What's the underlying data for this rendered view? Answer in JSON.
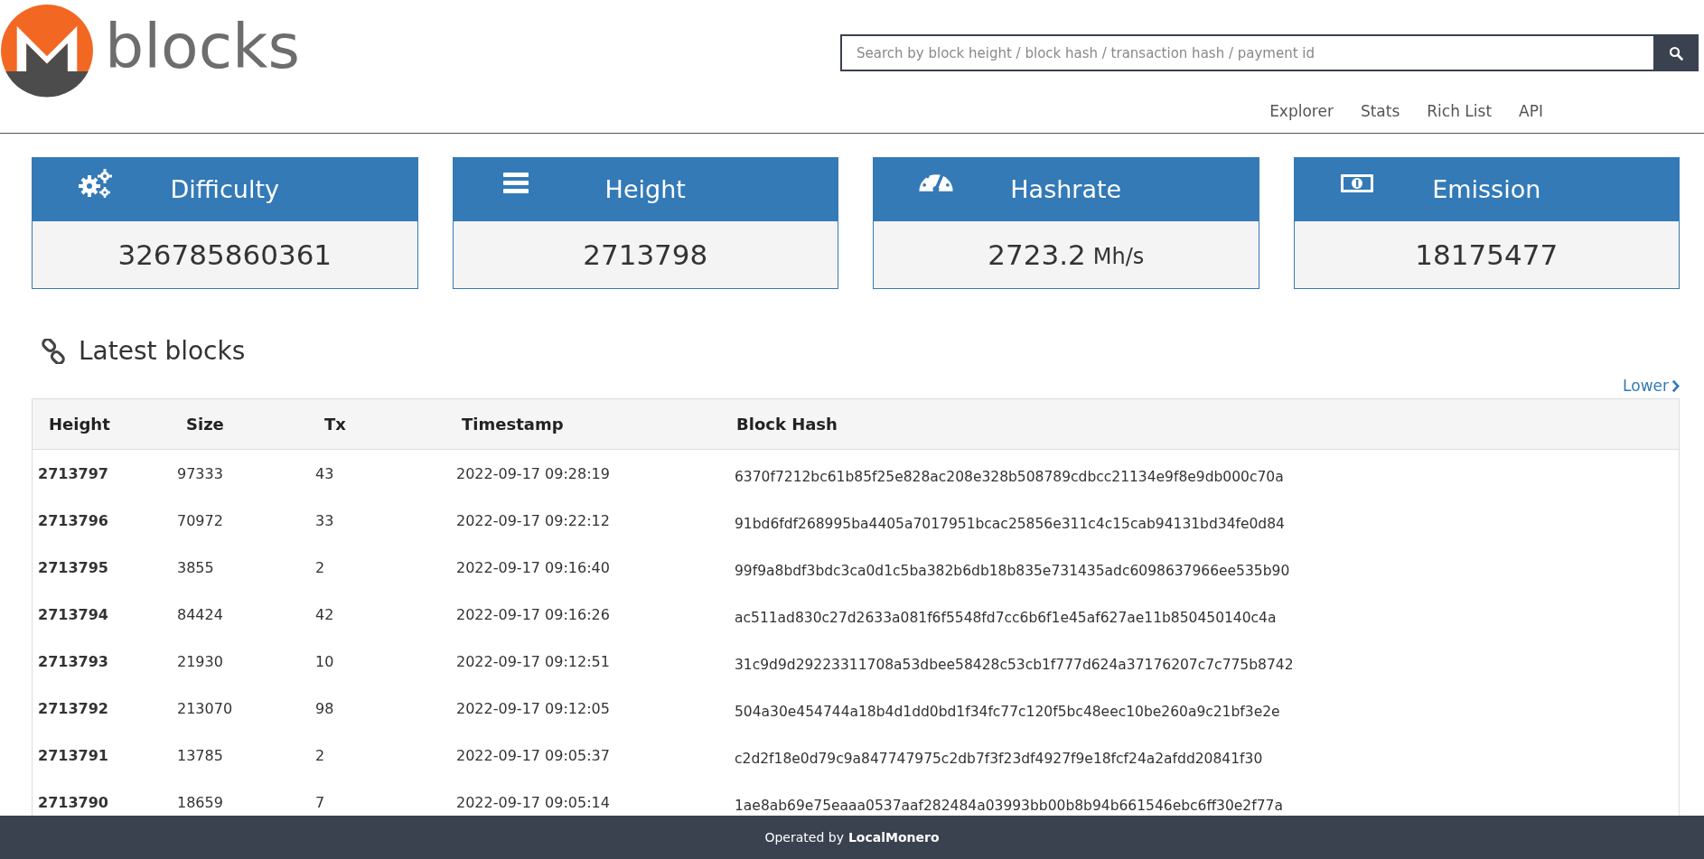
{
  "header": {
    "logo_text": "blocks",
    "search": {
      "placeholder": "Search by block height / block hash / transaction hash / payment id"
    },
    "nav": [
      {
        "label": "Explorer"
      },
      {
        "label": "Stats"
      },
      {
        "label": "Rich List"
      },
      {
        "label": "API"
      }
    ]
  },
  "stats": [
    {
      "kind": "gears",
      "title": "Difficulty",
      "value": "326785860361"
    },
    {
      "kind": "bars",
      "title": "Height",
      "value": "2713798"
    },
    {
      "kind": "gauge",
      "title": "Hashrate",
      "value": "2723.2",
      "unit": "Mh/s"
    },
    {
      "kind": "money",
      "title": "Emission",
      "value": "18175477"
    }
  ],
  "latest_blocks": {
    "title": "Latest blocks",
    "pager": "Lower",
    "columns": [
      "Height",
      "Size",
      "Tx",
      "Timestamp",
      "Block Hash"
    ],
    "rows": [
      [
        "2713797",
        "97333",
        "43",
        "2022-09-17 09:28:19",
        "6370f7212bc61b85f25e828ac208e328b508789cdbcc21134e9f8e9db000c70a"
      ],
      [
        "2713796",
        "70972",
        "33",
        "2022-09-17 09:22:12",
        "91bd6fdf268995ba4405a7017951bcac25856e311c4c15cab94131bd34fe0d84"
      ],
      [
        "2713795",
        "3855",
        "2",
        "2022-09-17 09:16:40",
        "99f9a8bdf3bdc3ca0d1c5ba382b6db18b835e731435adc6098637966ee535b90"
      ],
      [
        "2713794",
        "84424",
        "42",
        "2022-09-17 09:16:26",
        "ac511ad830c27d2633a081f6f5548fd7cc6b6f1e45af627ae11b850450140c4a"
      ],
      [
        "2713793",
        "21930",
        "10",
        "2022-09-17 09:12:51",
        "31c9d9d29223311708a53dbee58428c53cb1f777d624a37176207c7c775b8742"
      ],
      [
        "2713792",
        "213070",
        "98",
        "2022-09-17 09:12:05",
        "504a30e454744a18b4d1dd0bd1f34fc77c120f5bc48eec10be260a9c21bf3e2e"
      ],
      [
        "2713791",
        "13785",
        "2",
        "2022-09-17 09:05:37",
        "c2d2f18e0d79c9a847747975c2db7f3f23df4927f9e18fcf24a2afdd20841f30"
      ],
      [
        "2713790",
        "18659",
        "7",
        "2022-09-17 09:05:14",
        "1ae8ab69e75eaaa0537aaf282484a03993bb00b8b94b661546ebc6ff30e2f77a"
      ]
    ]
  },
  "footer": {
    "text": "Operated by",
    "link": "LocalMonero"
  }
}
